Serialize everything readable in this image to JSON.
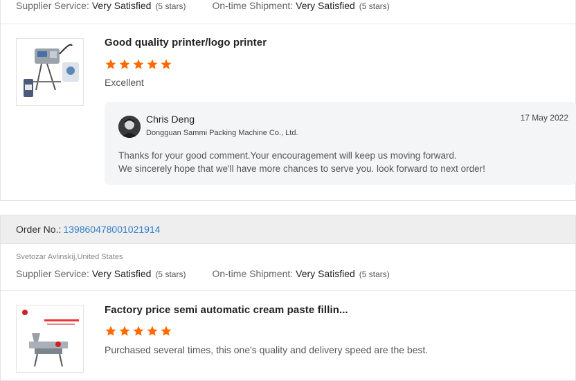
{
  "review1": {
    "supplier_label": "Supplier Service:",
    "supplier_value": "Very Satisfied",
    "supplier_stars": "(5 stars)",
    "shipment_label": "On-time Shipment:",
    "shipment_value": "Very Satisfied",
    "shipment_stars": "(5 stars)",
    "product_title": "Good quality printer/logo printer",
    "rating": 5,
    "comment": "Excellent",
    "reply": {
      "name": "Chris Deng",
      "company": "Dongguan Sammi Packing Machine Co., Ltd.",
      "date": "17 May 2022",
      "line1": "Thanks for your good comment.Your encouragement will keep us moving forward.",
      "line2": "We sincerely hope that we'll have more chances to serve you. look forward to next order!"
    }
  },
  "review2": {
    "order_label": "Order No.:",
    "order_number": "139860478001021914",
    "buyer": "Svetozar Avlinskij,United States",
    "supplier_label": "Supplier Service:",
    "supplier_value": "Very Satisfied",
    "supplier_stars": "(5 stars)",
    "shipment_label": "On-time Shipment:",
    "shipment_value": "Very Satisfied",
    "shipment_stars": "(5 stars)",
    "product_title": "Factory price semi automatic cream paste fillin...",
    "rating": 5,
    "comment": "Purchased several times, this one's quality and delivery speed are the best."
  },
  "colors": {
    "star": "#ff6a00",
    "order_link": "#2e7fc7",
    "order_bar_bg": "#eeeeee",
    "reply_bg": "#f4f5f7"
  },
  "icons": {
    "star": "star-icon",
    "avatar": "avatar"
  }
}
